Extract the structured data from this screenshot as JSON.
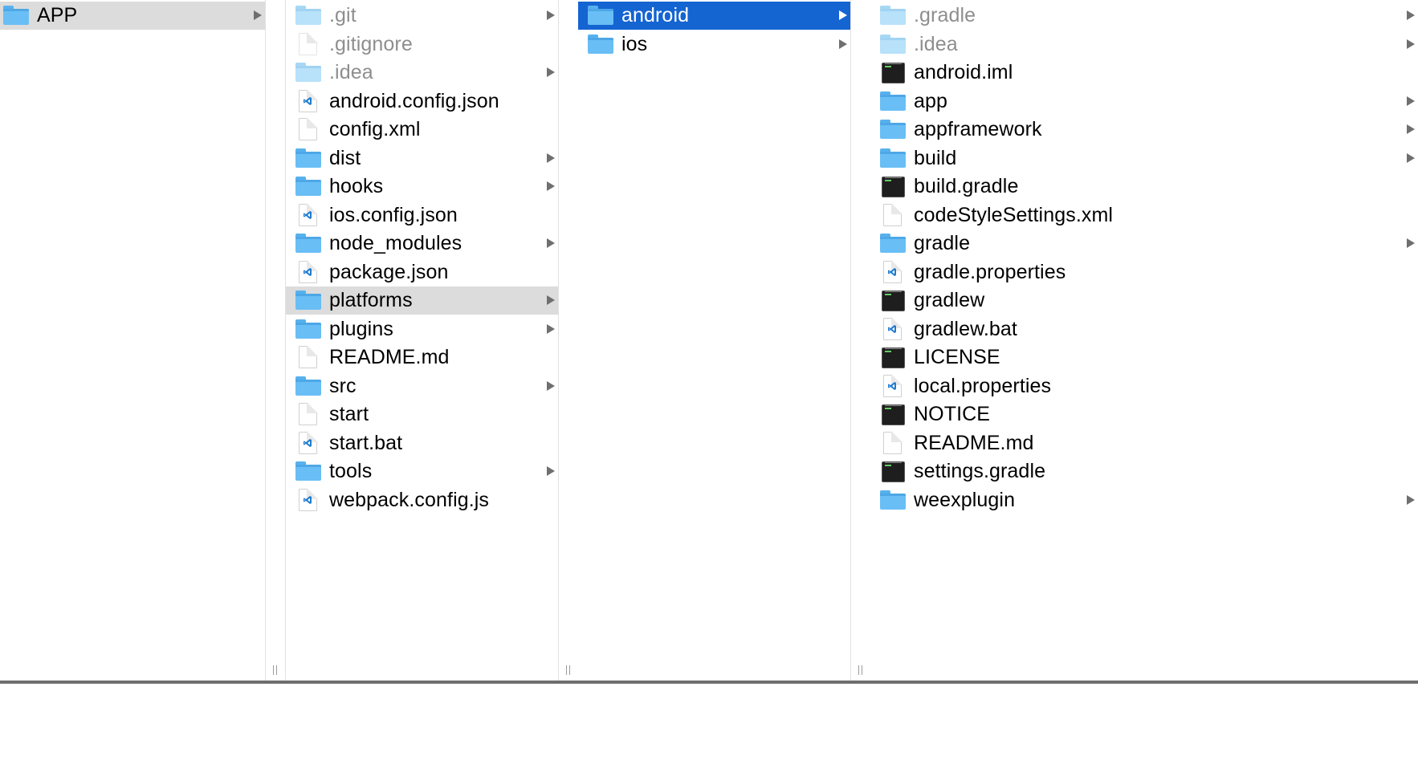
{
  "columns": [
    {
      "items": [
        {
          "name": "APP",
          "type": "folder",
          "arrow": true,
          "selected": "gray"
        }
      ]
    },
    {
      "items": [
        {
          "name": ".git",
          "type": "folder",
          "dim": true,
          "arrow": true
        },
        {
          "name": ".gitignore",
          "type": "doc",
          "dim": true
        },
        {
          "name": ".idea",
          "type": "folder",
          "dim": true,
          "arrow": true
        },
        {
          "name": "android.config.json",
          "type": "vscode"
        },
        {
          "name": "config.xml",
          "type": "doc"
        },
        {
          "name": "dist",
          "type": "folder",
          "arrow": true
        },
        {
          "name": "hooks",
          "type": "folder",
          "arrow": true
        },
        {
          "name": "ios.config.json",
          "type": "vscode"
        },
        {
          "name": "node_modules",
          "type": "folder",
          "arrow": true
        },
        {
          "name": "package.json",
          "type": "vscode"
        },
        {
          "name": "platforms",
          "type": "folder",
          "arrow": true,
          "selected": "gray"
        },
        {
          "name": "plugins",
          "type": "folder",
          "arrow": true
        },
        {
          "name": "README.md",
          "type": "doc"
        },
        {
          "name": "src",
          "type": "folder",
          "arrow": true
        },
        {
          "name": "start",
          "type": "doc"
        },
        {
          "name": "start.bat",
          "type": "vscode"
        },
        {
          "name": "tools",
          "type": "folder",
          "arrow": true
        },
        {
          "name": "webpack.config.js",
          "type": "vscode"
        }
      ]
    },
    {
      "items": [
        {
          "name": "android",
          "type": "folder",
          "arrow": true,
          "selected": "blue"
        },
        {
          "name": "ios",
          "type": "folder",
          "arrow": true
        }
      ]
    },
    {
      "items": [
        {
          "name": ".gradle",
          "type": "folder",
          "dim": true,
          "arrow": true
        },
        {
          "name": ".idea",
          "type": "folder",
          "dim": true,
          "arrow": true
        },
        {
          "name": "android.iml",
          "type": "terminal"
        },
        {
          "name": "app",
          "type": "folder",
          "arrow": true
        },
        {
          "name": "appframework",
          "type": "folder",
          "arrow": true
        },
        {
          "name": "build",
          "type": "folder",
          "arrow": true
        },
        {
          "name": "build.gradle",
          "type": "terminal"
        },
        {
          "name": "codeStyleSettings.xml",
          "type": "doc"
        },
        {
          "name": "gradle",
          "type": "folder",
          "arrow": true
        },
        {
          "name": "gradle.properties",
          "type": "vscode"
        },
        {
          "name": "gradlew",
          "type": "terminal"
        },
        {
          "name": "gradlew.bat",
          "type": "vscode"
        },
        {
          "name": "LICENSE",
          "type": "terminal"
        },
        {
          "name": "local.properties",
          "type": "vscode"
        },
        {
          "name": "NOTICE",
          "type": "terminal"
        },
        {
          "name": "README.md",
          "type": "doc"
        },
        {
          "name": "settings.gradle",
          "type": "terminal"
        },
        {
          "name": "weexplugin",
          "type": "folder",
          "arrow": true
        }
      ]
    }
  ],
  "colors": {
    "selection_active": "#1464d2",
    "selection_inactive": "#dcdcdc",
    "folder": "#69bef5",
    "vscode": "#1f7bd0"
  }
}
